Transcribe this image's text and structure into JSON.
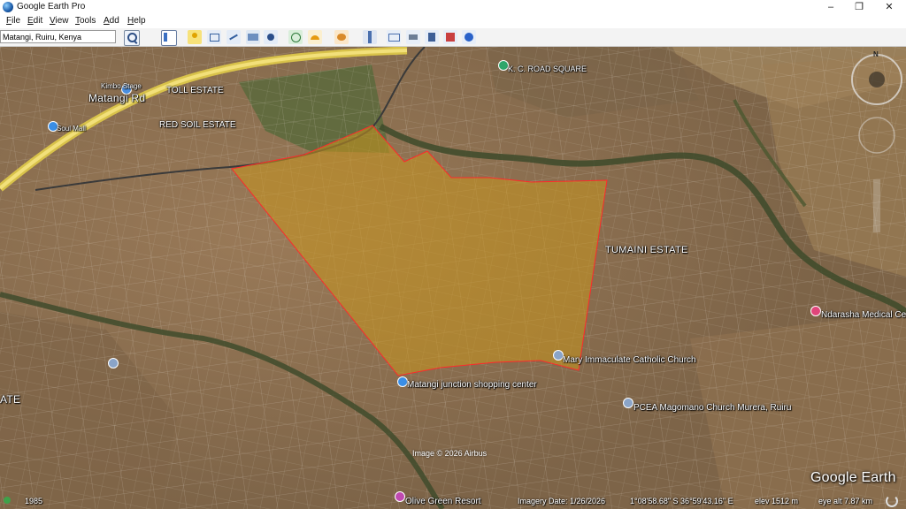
{
  "window": {
    "title": "Google Earth Pro",
    "minimize": "–",
    "restore": "❐",
    "close": "✕"
  },
  "menu": [
    "File",
    "Edit",
    "View",
    "Tools",
    "Add",
    "Help"
  ],
  "search": {
    "value": "Matangi, Ruiru, Kenya"
  },
  "toolbar_icons": [
    "sidebar-toggle-icon",
    "placemark-icon",
    "polygon-icon",
    "path-icon",
    "image-overlay-icon",
    "record-tour-icon",
    "historical-imagery-icon",
    "sun-icon",
    "planets-icon",
    "ruler-icon",
    "email-icon",
    "print-icon",
    "save-image-icon",
    "view-in-maps-icon",
    "google-earth-icon"
  ],
  "map": {
    "labels": {
      "kimbo_stage": "Kimbo Stage",
      "matangi_rd": "Matangi Rd",
      "toll_estate": "TOLL ESTATE",
      "red_soil": "RED SOIL ESTATE",
      "soul_mall": "Soul Mall",
      "kc_road": "K. C. ROAD SQUARE",
      "tumaini": "TUMAINI ESTATE",
      "ndarasha": "Ndarasha Medical Ce",
      "mary_church": "Mary Immaculate Catholic Church",
      "junction": "Matangi junction shopping center",
      "pcea": "PCEA Magomano Church Murera, Ruiru",
      "olive": "Olive Green Resort",
      "ate": "ATE",
      "credit": "Image © 2026 Airbus"
    },
    "compass_north": "N",
    "brand": "Google Earth",
    "overlay_color": "#c8961e",
    "outline_color": "#ff2a2a"
  },
  "status": {
    "year": "1985",
    "imagery_date": "Imagery Date: 1/26/2026",
    "coords": "1°08'58.68\" S   36°59'43.16\" E",
    "elev": "elev  1512 m",
    "eye_alt": "eye alt   7.87 km"
  }
}
